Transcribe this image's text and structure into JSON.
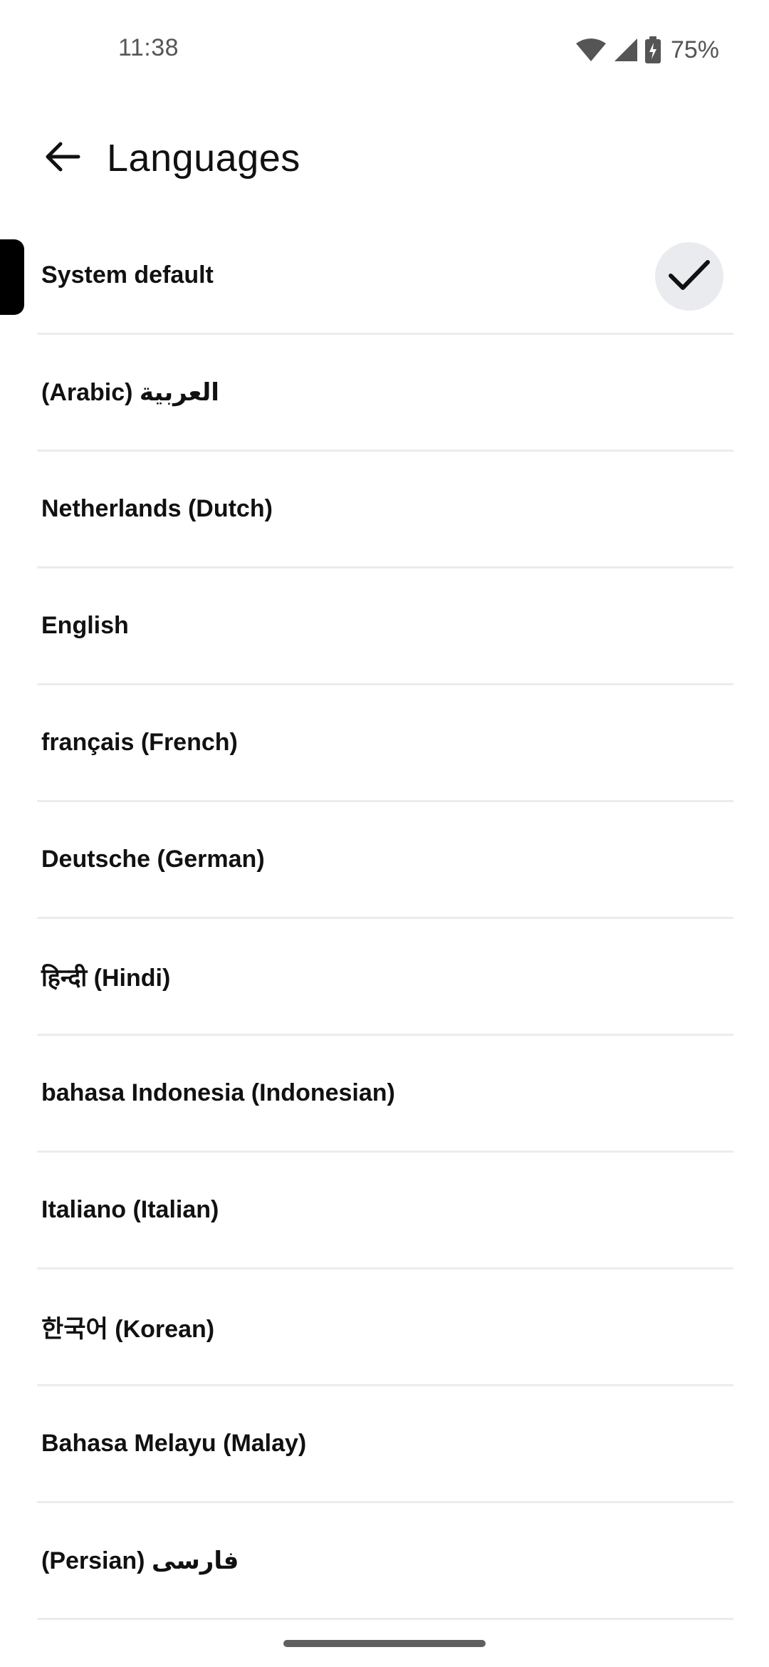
{
  "status": {
    "time": "11:38",
    "battery": "75%"
  },
  "header": {
    "title": "Languages"
  },
  "languages": [
    {
      "label": "System default",
      "selected": true
    },
    {
      "label": "(Arabic) العربية",
      "selected": false
    },
    {
      "label": "Netherlands (Dutch)",
      "selected": false
    },
    {
      "label": "English",
      "selected": false
    },
    {
      "label": "français (French)",
      "selected": false
    },
    {
      "label": "Deutsche (German)",
      "selected": false
    },
    {
      "label": "हिन्दी (Hindi)",
      "selected": false
    },
    {
      "label": "bahasa Indonesia (Indonesian)",
      "selected": false
    },
    {
      "label": "Italiano (Italian)",
      "selected": false
    },
    {
      "label": "한국어 (Korean)",
      "selected": false
    },
    {
      "label": "Bahasa Melayu (Malay)",
      "selected": false
    },
    {
      "label": "(Persian) فارسی",
      "selected": false
    }
  ],
  "icons": {
    "back": "arrow-back-icon",
    "check": "check-icon",
    "wifi": "wifi-icon",
    "signal": "cell-signal-icon",
    "battery": "battery-charging-icon"
  },
  "colors": {
    "indicator": "#000000",
    "check_bg": "#e9ebef",
    "divider": "#ececec"
  }
}
